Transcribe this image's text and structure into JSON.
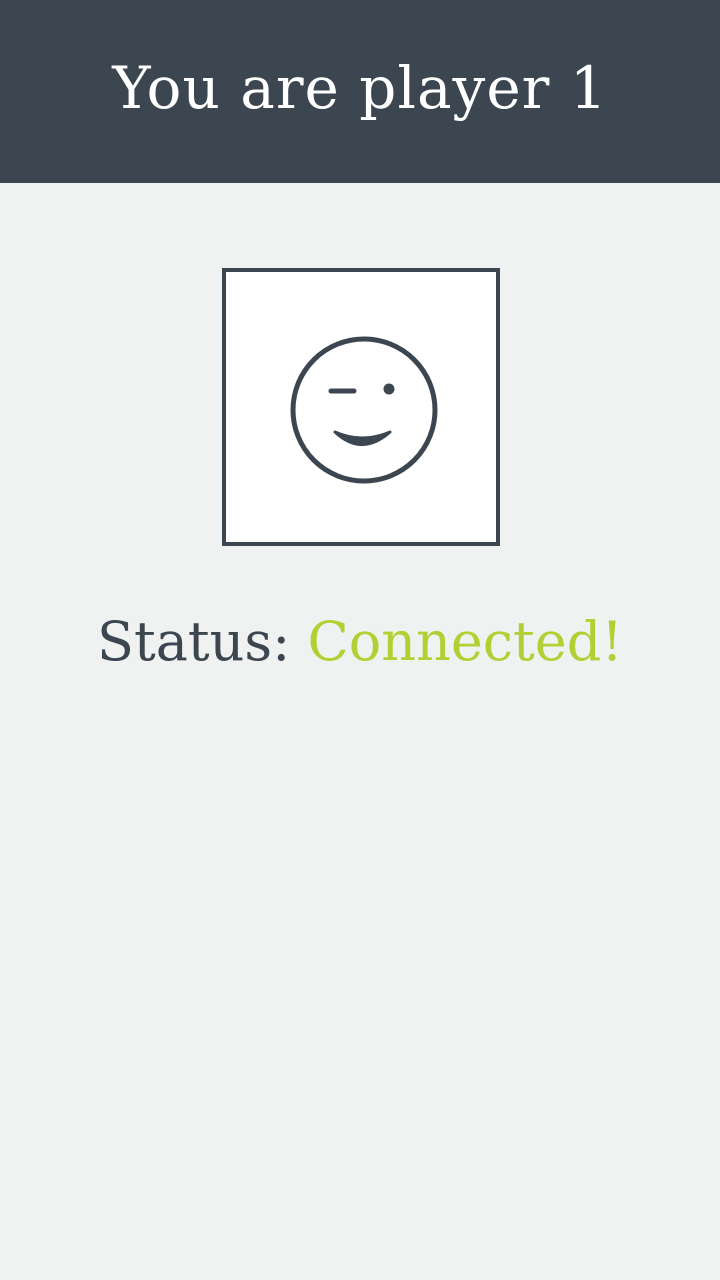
{
  "header": {
    "title": "You are player 1"
  },
  "avatar": {
    "icon": "winking-face-icon"
  },
  "status": {
    "label": "Status:",
    "value": "Connected!"
  },
  "colors": {
    "header_bg": "#3c4650",
    "page_bg": "#f0f1f1",
    "status_connected": "#b3cf34",
    "text_dark": "#3c4650"
  }
}
